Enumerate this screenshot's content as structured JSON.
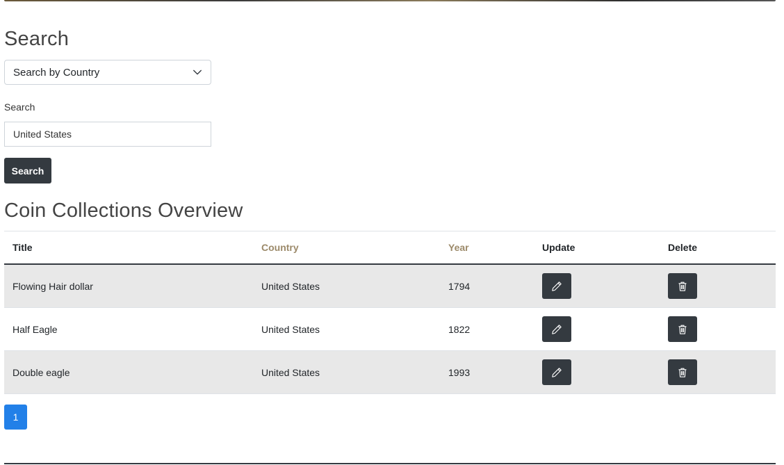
{
  "search_section": {
    "heading": "Search",
    "select_value": "Search by Country",
    "field_label": "Search",
    "input_value": "United States",
    "button_label": "Search"
  },
  "overview": {
    "heading": "Coin Collections Overview",
    "columns": {
      "title": "Title",
      "country": "Country",
      "year": "Year",
      "update": "Update",
      "delete": "Delete"
    },
    "rows": [
      {
        "title": "Flowing Hair dollar",
        "country": "United States",
        "year": "1794"
      },
      {
        "title": "Half Eagle",
        "country": "United States",
        "year": "1822"
      },
      {
        "title": "Double eagle",
        "country": "United States",
        "year": "1993"
      }
    ]
  },
  "pagination": {
    "current_page": "1"
  },
  "icons": {
    "select_indicator": "chevron-down-icon",
    "update": "pencil-icon",
    "delete": "trash-icon"
  },
  "colors": {
    "dark_button": "#343a40",
    "sortable_header": "#9c8a6a",
    "active_page": "#2280e8",
    "striped_row": "#e8e8e8"
  }
}
